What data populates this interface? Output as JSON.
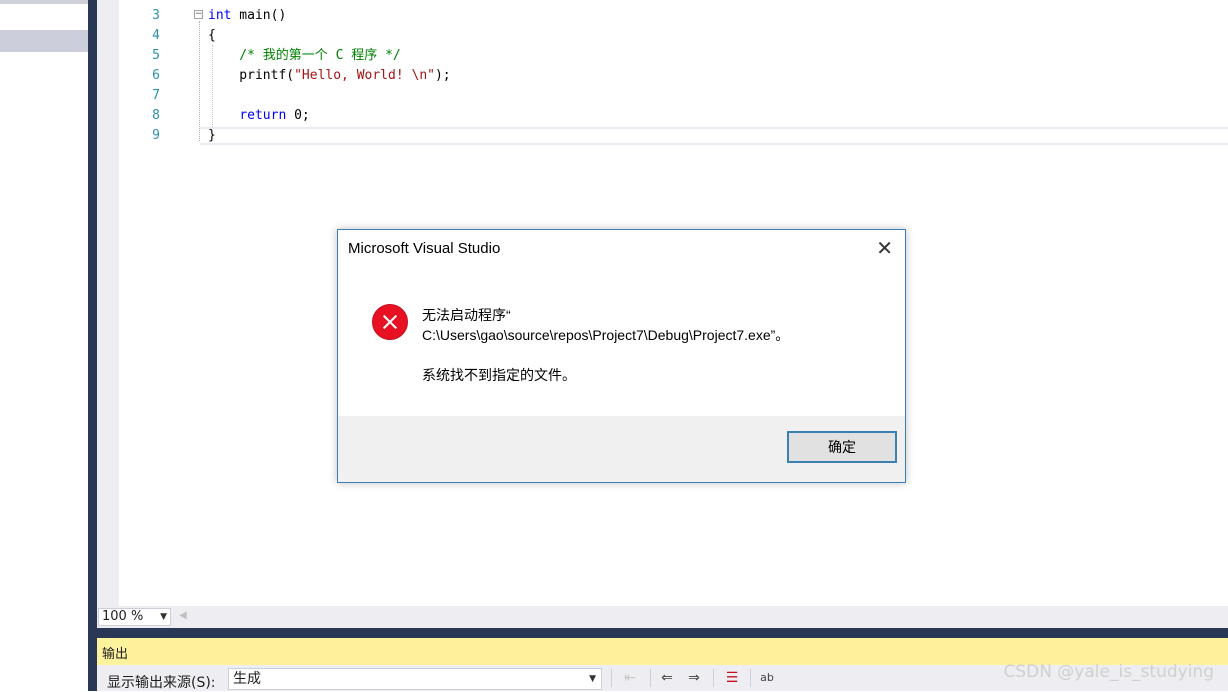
{
  "editor": {
    "line_numbers": [
      "3",
      "4",
      "5",
      "6",
      "7",
      "8",
      "9"
    ],
    "lines": [
      [
        {
          "t": "int",
          "c": "kw"
        },
        {
          "t": " main()",
          "c": ""
        }
      ],
      [
        {
          "t": "{",
          "c": ""
        }
      ],
      [
        {
          "t": "    /* 我的第一个 C 程序 */",
          "c": "cm"
        }
      ],
      [
        {
          "t": "    printf(",
          "c": ""
        },
        {
          "t": "\"Hello, World! \\n\"",
          "c": "st"
        },
        {
          "t": ");",
          "c": ""
        }
      ],
      [
        {
          "t": "",
          "c": ""
        }
      ],
      [
        {
          "t": "    ",
          "c": ""
        },
        {
          "t": "return",
          "c": "kw"
        },
        {
          "t": " 0;",
          "c": ""
        }
      ],
      [
        {
          "t": "}",
          "c": ""
        }
      ]
    ],
    "zoom": "100 %"
  },
  "dialog": {
    "title": "Microsoft Visual Studio",
    "message_line1": "无法启动程序“",
    "message_line2": "C:\\Users\\gao\\source\\repos\\Project7\\Debug\\Project7.exe”。",
    "message_line3": "系统找不到指定的文件。",
    "ok_label": "确定",
    "icon": "error-icon"
  },
  "output_panel": {
    "title": "输出",
    "source_label": "显示输出来源(S):",
    "source_value": "生成"
  },
  "watermark": "CSDN @yale_is_studying",
  "colors": {
    "keyword": "#0000ff",
    "comment": "#008000",
    "string": "#a31515",
    "line_number": "#2b91af",
    "frame": "#293955",
    "output_header": "#fff29d",
    "error": "#e81123"
  }
}
